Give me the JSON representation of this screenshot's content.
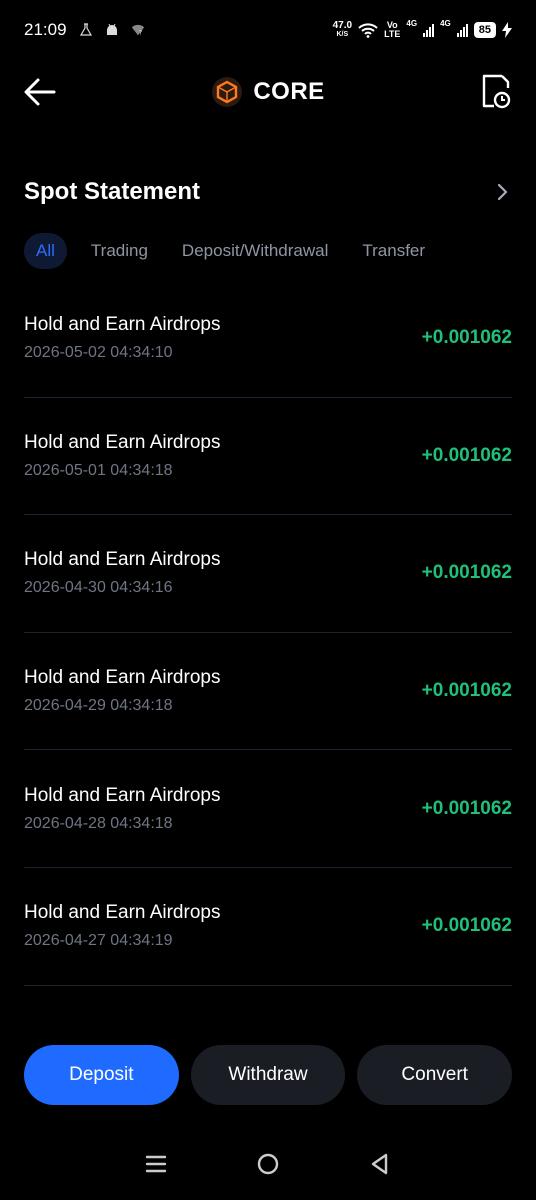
{
  "status_bar": {
    "time": "21:09",
    "net_speed_value": "47.0",
    "net_speed_unit": "K/S",
    "volte_top": "Vo",
    "volte_bottom": "LTE",
    "sim1_tag": "4G",
    "sim2_tag": "4G",
    "battery": "85"
  },
  "header": {
    "title": "CORE",
    "back_icon": "arrow-left-icon",
    "history_icon": "document-clock-icon",
    "logo_color": "#ff7a1a"
  },
  "section": {
    "title": "Spot Statement"
  },
  "tabs": [
    {
      "label": "All",
      "active": true
    },
    {
      "label": "Trading",
      "active": false
    },
    {
      "label": "Deposit/Withdrawal",
      "active": false
    },
    {
      "label": "Transfer",
      "active": false
    }
  ],
  "transactions": [
    {
      "title": "Hold and Earn Airdrops",
      "time": "2026-05-02 04:34:10",
      "amount": "+0.001062"
    },
    {
      "title": "Hold and Earn Airdrops",
      "time": "2026-05-01 04:34:18",
      "amount": "+0.001062"
    },
    {
      "title": "Hold and Earn Airdrops",
      "time": "2026-04-30 04:34:16",
      "amount": "+0.001062"
    },
    {
      "title": "Hold and Earn Airdrops",
      "time": "2026-04-29 04:34:18",
      "amount": "+0.001062"
    },
    {
      "title": "Hold and Earn Airdrops",
      "time": "2026-04-28 04:34:18",
      "amount": "+0.001062"
    },
    {
      "title": "Hold and Earn Airdrops",
      "time": "2026-04-27 04:34:19",
      "amount": "+0.001062"
    }
  ],
  "actions": {
    "deposit": "Deposit",
    "withdraw": "Withdraw",
    "convert": "Convert"
  },
  "colors": {
    "accent": "#1f6bff",
    "positive": "#20c07a"
  }
}
